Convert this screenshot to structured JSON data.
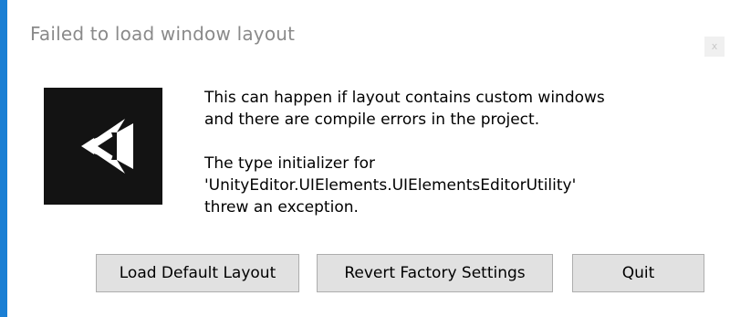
{
  "window": {
    "title": "Failed to load window layout",
    "close_glyph": "x"
  },
  "icon": {
    "name": "unity-logo-icon"
  },
  "message": {
    "line1": "This can happen if layout contains custom windows\nand there are compile errors in the project.",
    "line2": "The type initializer for\n'UnityEditor.UIElements.UIElementsEditorUtility'\nthrew an exception."
  },
  "buttons": {
    "load_default_layout": "Load Default Layout",
    "revert_factory_settings": "Revert Factory Settings",
    "quit": "Quit"
  },
  "colors": {
    "accent_border": "#1a7fd4",
    "title_text": "#8a8a8a",
    "logo_background": "#131313",
    "button_face": "#e1e1e1",
    "button_border": "#adadad"
  }
}
